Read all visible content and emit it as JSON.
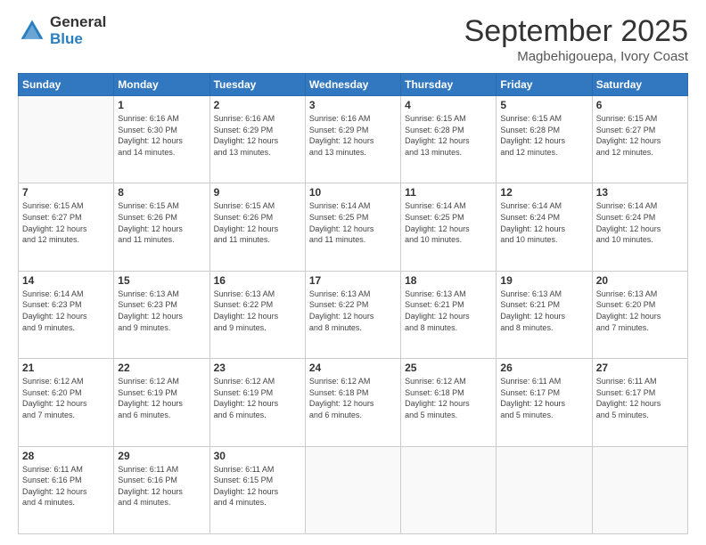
{
  "logo": {
    "general": "General",
    "blue": "Blue"
  },
  "title": "September 2025",
  "subtitle": "Magbehigouepa, Ivory Coast",
  "weekdays": [
    "Sunday",
    "Monday",
    "Tuesday",
    "Wednesday",
    "Thursday",
    "Friday",
    "Saturday"
  ],
  "weeks": [
    [
      {
        "day": "",
        "info": ""
      },
      {
        "day": "1",
        "info": "Sunrise: 6:16 AM\nSunset: 6:30 PM\nDaylight: 12 hours\nand 14 minutes."
      },
      {
        "day": "2",
        "info": "Sunrise: 6:16 AM\nSunset: 6:29 PM\nDaylight: 12 hours\nand 13 minutes."
      },
      {
        "day": "3",
        "info": "Sunrise: 6:16 AM\nSunset: 6:29 PM\nDaylight: 12 hours\nand 13 minutes."
      },
      {
        "day": "4",
        "info": "Sunrise: 6:15 AM\nSunset: 6:28 PM\nDaylight: 12 hours\nand 13 minutes."
      },
      {
        "day": "5",
        "info": "Sunrise: 6:15 AM\nSunset: 6:28 PM\nDaylight: 12 hours\nand 12 minutes."
      },
      {
        "day": "6",
        "info": "Sunrise: 6:15 AM\nSunset: 6:27 PM\nDaylight: 12 hours\nand 12 minutes."
      }
    ],
    [
      {
        "day": "7",
        "info": "Sunrise: 6:15 AM\nSunset: 6:27 PM\nDaylight: 12 hours\nand 12 minutes."
      },
      {
        "day": "8",
        "info": "Sunrise: 6:15 AM\nSunset: 6:26 PM\nDaylight: 12 hours\nand 11 minutes."
      },
      {
        "day": "9",
        "info": "Sunrise: 6:15 AM\nSunset: 6:26 PM\nDaylight: 12 hours\nand 11 minutes."
      },
      {
        "day": "10",
        "info": "Sunrise: 6:14 AM\nSunset: 6:25 PM\nDaylight: 12 hours\nand 11 minutes."
      },
      {
        "day": "11",
        "info": "Sunrise: 6:14 AM\nSunset: 6:25 PM\nDaylight: 12 hours\nand 10 minutes."
      },
      {
        "day": "12",
        "info": "Sunrise: 6:14 AM\nSunset: 6:24 PM\nDaylight: 12 hours\nand 10 minutes."
      },
      {
        "day": "13",
        "info": "Sunrise: 6:14 AM\nSunset: 6:24 PM\nDaylight: 12 hours\nand 10 minutes."
      }
    ],
    [
      {
        "day": "14",
        "info": "Sunrise: 6:14 AM\nSunset: 6:23 PM\nDaylight: 12 hours\nand 9 minutes."
      },
      {
        "day": "15",
        "info": "Sunrise: 6:13 AM\nSunset: 6:23 PM\nDaylight: 12 hours\nand 9 minutes."
      },
      {
        "day": "16",
        "info": "Sunrise: 6:13 AM\nSunset: 6:22 PM\nDaylight: 12 hours\nand 9 minutes."
      },
      {
        "day": "17",
        "info": "Sunrise: 6:13 AM\nSunset: 6:22 PM\nDaylight: 12 hours\nand 8 minutes."
      },
      {
        "day": "18",
        "info": "Sunrise: 6:13 AM\nSunset: 6:21 PM\nDaylight: 12 hours\nand 8 minutes."
      },
      {
        "day": "19",
        "info": "Sunrise: 6:13 AM\nSunset: 6:21 PM\nDaylight: 12 hours\nand 8 minutes."
      },
      {
        "day": "20",
        "info": "Sunrise: 6:13 AM\nSunset: 6:20 PM\nDaylight: 12 hours\nand 7 minutes."
      }
    ],
    [
      {
        "day": "21",
        "info": "Sunrise: 6:12 AM\nSunset: 6:20 PM\nDaylight: 12 hours\nand 7 minutes."
      },
      {
        "day": "22",
        "info": "Sunrise: 6:12 AM\nSunset: 6:19 PM\nDaylight: 12 hours\nand 6 minutes."
      },
      {
        "day": "23",
        "info": "Sunrise: 6:12 AM\nSunset: 6:19 PM\nDaylight: 12 hours\nand 6 minutes."
      },
      {
        "day": "24",
        "info": "Sunrise: 6:12 AM\nSunset: 6:18 PM\nDaylight: 12 hours\nand 6 minutes."
      },
      {
        "day": "25",
        "info": "Sunrise: 6:12 AM\nSunset: 6:18 PM\nDaylight: 12 hours\nand 5 minutes."
      },
      {
        "day": "26",
        "info": "Sunrise: 6:11 AM\nSunset: 6:17 PM\nDaylight: 12 hours\nand 5 minutes."
      },
      {
        "day": "27",
        "info": "Sunrise: 6:11 AM\nSunset: 6:17 PM\nDaylight: 12 hours\nand 5 minutes."
      }
    ],
    [
      {
        "day": "28",
        "info": "Sunrise: 6:11 AM\nSunset: 6:16 PM\nDaylight: 12 hours\nand 4 minutes."
      },
      {
        "day": "29",
        "info": "Sunrise: 6:11 AM\nSunset: 6:16 PM\nDaylight: 12 hours\nand 4 minutes."
      },
      {
        "day": "30",
        "info": "Sunrise: 6:11 AM\nSunset: 6:15 PM\nDaylight: 12 hours\nand 4 minutes."
      },
      {
        "day": "",
        "info": ""
      },
      {
        "day": "",
        "info": ""
      },
      {
        "day": "",
        "info": ""
      },
      {
        "day": "",
        "info": ""
      }
    ]
  ]
}
